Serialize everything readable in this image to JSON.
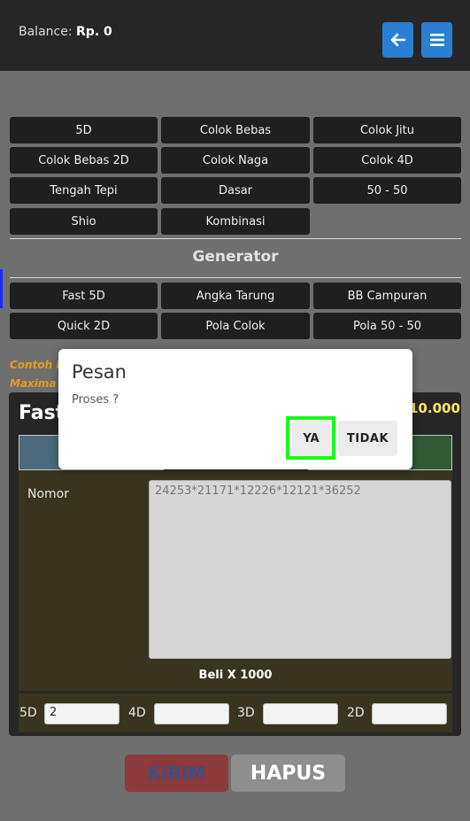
{
  "header": {
    "balance_label": "Balance:",
    "balance_value": "Rp. 0",
    "back_icon": "arrow-left-icon",
    "menu_icon": "hamburger-menu-icon"
  },
  "game_buttons": [
    "5D",
    "Colok Bebas",
    "Colok Jitu",
    "Colok Bebas 2D",
    "Colok Naga",
    "Colok 4D",
    "Tengah Tepi",
    "Dasar",
    "50 - 50",
    "Shio",
    "Kombinasi"
  ],
  "generator": {
    "title": "Generator",
    "buttons": [
      "Fast 5D",
      "Angka Tarung",
      "BB Campuran",
      "Quick 2D",
      "Pola Colok",
      "Pola 50 - 50"
    ]
  },
  "notes": {
    "line1": "Contoh I",
    "line2": "Maxima"
  },
  "panel": {
    "title": "Fast",
    "amount": "10.000",
    "nomor_label": "Nomor",
    "nomor_placeholder": "24253*21171*12226*12121*36252",
    "beli_text": "Beli X 1000",
    "inputs": [
      {
        "label": "5D",
        "value": "2"
      },
      {
        "label": "4D",
        "value": ""
      },
      {
        "label": "3D",
        "value": ""
      },
      {
        "label": "2D",
        "value": ""
      }
    ]
  },
  "actions": {
    "kirim": "KIRIM",
    "hapus": "HAPUS"
  },
  "modal": {
    "title": "Pesan",
    "message": "Proses ?",
    "ya": "YA",
    "tidak": "TIDAK"
  },
  "colors": {
    "accent_blue": "#2a7fd4",
    "highlight_green": "#14ff14",
    "amount_yellow": "#ffe85a",
    "note_orange": "#e89a1d"
  }
}
